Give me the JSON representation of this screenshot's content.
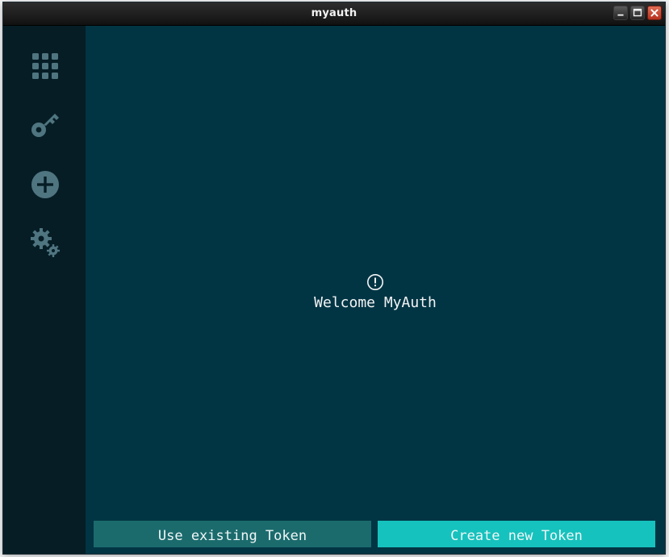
{
  "window": {
    "title": "myauth"
  },
  "sidebar": {
    "items": [
      {
        "name": "grid-icon"
      },
      {
        "name": "key-icon"
      },
      {
        "name": "add-circle-icon"
      },
      {
        "name": "gears-icon"
      }
    ]
  },
  "main": {
    "welcome_text": "Welcome MyAuth",
    "info_icon": "alert-circle-icon"
  },
  "buttons": {
    "use_existing": "Use existing Token",
    "create_new": "Create new Token"
  },
  "colors": {
    "sidebar_bg": "#061d25",
    "main_bg": "#023544",
    "icon_color": "#4f7580",
    "button_dark": "#1b6b6d",
    "button_accent": "#16c2bd",
    "text": "#f2f4f5"
  }
}
